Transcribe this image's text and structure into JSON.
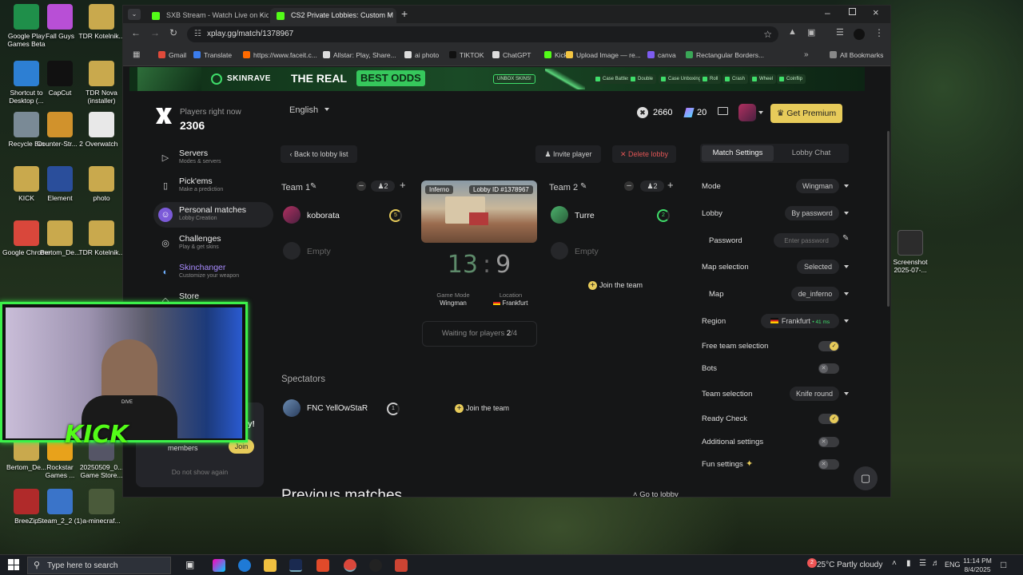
{
  "desktop": {
    "icons_left": [
      {
        "label": "Google Play Games Beta",
        "color": "#1f8f4a"
      },
      {
        "label": "Fall Guys",
        "color": "#b84fd6"
      },
      {
        "label": "TDR Kotelnik...",
        "color": "#c9a94d"
      },
      {
        "label": "Shortcut to Desktop (...",
        "color": "#2d7fd3"
      },
      {
        "label": "CapCut",
        "color": "#111111"
      },
      {
        "label": "TDR Nova (installer)",
        "color": "#c9a94d"
      },
      {
        "label": "Recycle Bin",
        "color": "#7a8a96"
      },
      {
        "label": "Counter-Str... 2",
        "color": "#d1922c"
      },
      {
        "label": "Overwatch",
        "color": "#e8e8e8"
      },
      {
        "label": "KICK",
        "color": "#c9a94d"
      },
      {
        "label": "Element",
        "color": "#2a4e9b"
      },
      {
        "label": "photo",
        "color": "#c9a94d"
      },
      {
        "label": "Google Chrome",
        "color": "#d9473b"
      },
      {
        "label": "Bertom_De...",
        "color": "#c9a94d"
      },
      {
        "label": "TDR Kotelnik...",
        "color": "#c9a94d"
      },
      {
        "label": "Bertom_De...",
        "color": "#c9a94d"
      },
      {
        "label": "Rockstar Games ...",
        "color": "#e8a21b"
      },
      {
        "label": "20250509_0... Game Store...",
        "color": "#556"
      },
      {
        "label": "BreeZip",
        "color": "#b02a2a"
      },
      {
        "label": "Steam_2_2 (1)",
        "color": "#3a74c9"
      },
      {
        "label": "a-minecraf...",
        "color": "#4a5a3a"
      }
    ],
    "icon_right": {
      "label": "Screenshot 2025-07-..."
    }
  },
  "browser": {
    "tabs": [
      {
        "title": "SXB Stream - Watch Live on Kic",
        "color": "#53fc18"
      },
      {
        "title": "CS2 Private Lobbies: Custom M",
        "color": "#53fc18"
      }
    ],
    "url": "xplay.gg/match/1378967",
    "bookmarks": [
      {
        "label": "Gmail",
        "color": "#e04a3a"
      },
      {
        "label": "Translate",
        "color": "#3b7ded"
      },
      {
        "label": "https://www.faceit.c...",
        "color": "#ff6a00"
      },
      {
        "label": "Allstar: Play, Share...",
        "color": "#dddddd"
      },
      {
        "label": "ai photo",
        "color": "#dddddd"
      },
      {
        "label": "TIKTOK",
        "color": "#111111"
      },
      {
        "label": "ChatGPT",
        "color": "#dddddd"
      },
      {
        "label": "Kick",
        "color": "#53fc18"
      },
      {
        "label": "Upload Image — re...",
        "color": "#f4c542"
      },
      {
        "label": "canva",
        "color": "#7d5cf0"
      },
      {
        "label": "Rectangular Borders...",
        "color": "#3aa757"
      }
    ],
    "all_bookmarks": "All Bookmarks"
  },
  "banner": {
    "brand": "SKINRAVE",
    "headline": "THE REAL",
    "highlight": "BEST ODDS",
    "badge": "UNBOX SKINS!",
    "links": [
      "Case Battles",
      "Double",
      "Case Unboxing",
      "Roll",
      "Crash",
      "Wheel",
      "Coinflip"
    ]
  },
  "sidebar": {
    "players_label": "Players right now",
    "players_count": "2306",
    "items": [
      {
        "title": "Servers",
        "sub": "Modes & servers",
        "icon": "▷"
      },
      {
        "title": "Pick'ems",
        "sub": "Make a prediction",
        "icon": "▯"
      },
      {
        "title": "Personal matches",
        "sub": "Lobby Creation",
        "icon": "☺"
      },
      {
        "title": "Challenges",
        "sub": "Play & get skins",
        "icon": "◎"
      },
      {
        "title": "Skinchanger",
        "sub": "Customize your weapon",
        "icon": "◐"
      },
      {
        "title": "Store",
        "sub": "",
        "icon": "◇"
      }
    ],
    "promo_members": "members",
    "promo_join": "Join",
    "promo_dismiss": "Do not show again",
    "promo_tail": "y!"
  },
  "topbar": {
    "language": "English",
    "coins": "2660",
    "gems": "20",
    "premium": "Get Premium"
  },
  "lobby": {
    "back": "Back to lobby list",
    "invite": "Invite player",
    "delete": "Delete lobby",
    "team1": {
      "name": "Team 1",
      "count": "2",
      "players": [
        {
          "name": "koborata",
          "level": "5"
        },
        {
          "name": "Empty"
        }
      ]
    },
    "team2": {
      "name": "Team 2",
      "count": "2",
      "players": [
        {
          "name": "Turre",
          "level": "2"
        },
        {
          "name": "Empty"
        }
      ],
      "join": "Join the team"
    },
    "map_name": "Inferno",
    "lobby_id": "Lobby ID #1378967",
    "score_left": "13",
    "score_sep": ":",
    "score_right": "9",
    "game_mode_label": "Game Mode",
    "game_mode": "Wingman",
    "location_label": "Location",
    "location": "Frankfurt",
    "waiting_prefix": "Waiting for players ",
    "waiting_current": "2",
    "waiting_total": "/4",
    "spectators_title": "Spectators",
    "spectator": {
      "name": "FNC YellOwStaR",
      "level": "1"
    },
    "spectator_join": "Join the team",
    "previous_matches": "Previous matches",
    "go_to_lobby": "Go to lobby"
  },
  "settings": {
    "tab_active": "Match Settings",
    "tab_other": "Lobby Chat",
    "mode_label": "Mode",
    "mode": "Wingman",
    "lobby_label": "Lobby",
    "lobby": "By password",
    "password_label": "Password",
    "password_placeholder": "Enter password",
    "map_selection_label": "Map selection",
    "map_selection": "Selected",
    "map_label": "Map",
    "map": "de_inferno",
    "region_label": "Region",
    "region": "Frankfurt",
    "region_ping": "• 41 ms",
    "free_team_label": "Free team selection",
    "free_team_on": true,
    "bots_label": "Bots",
    "bots_on": false,
    "team_selection_label": "Team selection",
    "team_selection": "Knife round",
    "ready_check_label": "Ready Check",
    "ready_check_on": true,
    "additional_label": "Additional settings",
    "additional_on": false,
    "fun_label": "Fun settings",
    "fun_on": false
  },
  "webcam": {
    "logo": "KICK",
    "shirt_text": "DIVE"
  },
  "taskbar": {
    "search": "Type here to search",
    "weather": "25°C  Partly cloudy",
    "lang": "ENG",
    "time": "11:14 PM",
    "date": "8/4/2025",
    "notify_badge": "2"
  },
  "colors": {
    "accent": "#e7cb5a",
    "danger": "#e05555",
    "kick": "#53fc18",
    "personal_active": "#2f3034"
  }
}
